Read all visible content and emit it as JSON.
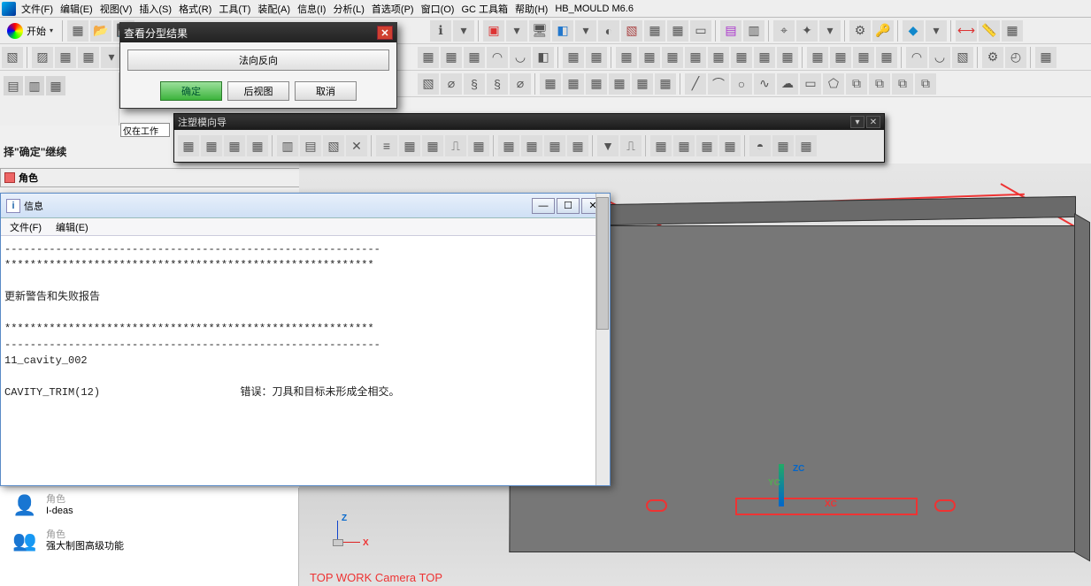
{
  "menubar": {
    "items": [
      "文件(F)",
      "编辑(E)",
      "视图(V)",
      "插入(S)",
      "格式(R)",
      "工具(T)",
      "装配(A)",
      "信息(I)",
      "分析(L)",
      "首选项(P)",
      "窗口(O)",
      "GC 工具箱",
      "帮助(H)",
      "HB_MOULD M6.6"
    ]
  },
  "start": {
    "label": "开始"
  },
  "dialog": {
    "title": "查看分型结果",
    "wide_btn": "法向反向",
    "ok": "确定",
    "back_view": "后视图",
    "cancel": "取消"
  },
  "float_tb": {
    "title": "注塑模向导"
  },
  "status": {
    "text": "择\"确定\"继续"
  },
  "role_bar": {
    "label": "角色"
  },
  "filter": {
    "placeholder": "仅在工作"
  },
  "info": {
    "title": "信息",
    "menu": [
      "文件(F)",
      "编辑(E)"
    ],
    "body": "-----------------------------------------------------------\n**********************************************************\n\n更新警告和失败报告\n\n**********************************************************\n-----------------------------------------------------------\n11_cavity_002\n\nCAVITY_TRIM(12)                      错误：刀具和目标未形成全相交。"
  },
  "roles": {
    "items": [
      {
        "line1": "角色",
        "line2": "I-deas"
      },
      {
        "line1": "角色",
        "line2": "强大制图高级功能"
      }
    ]
  },
  "viewport": {
    "zc": "ZC",
    "xc": "XC",
    "yc": "YC",
    "mini_z": "Z",
    "mini_x": "X",
    "camera": "TOP WORK Camera TOP"
  }
}
